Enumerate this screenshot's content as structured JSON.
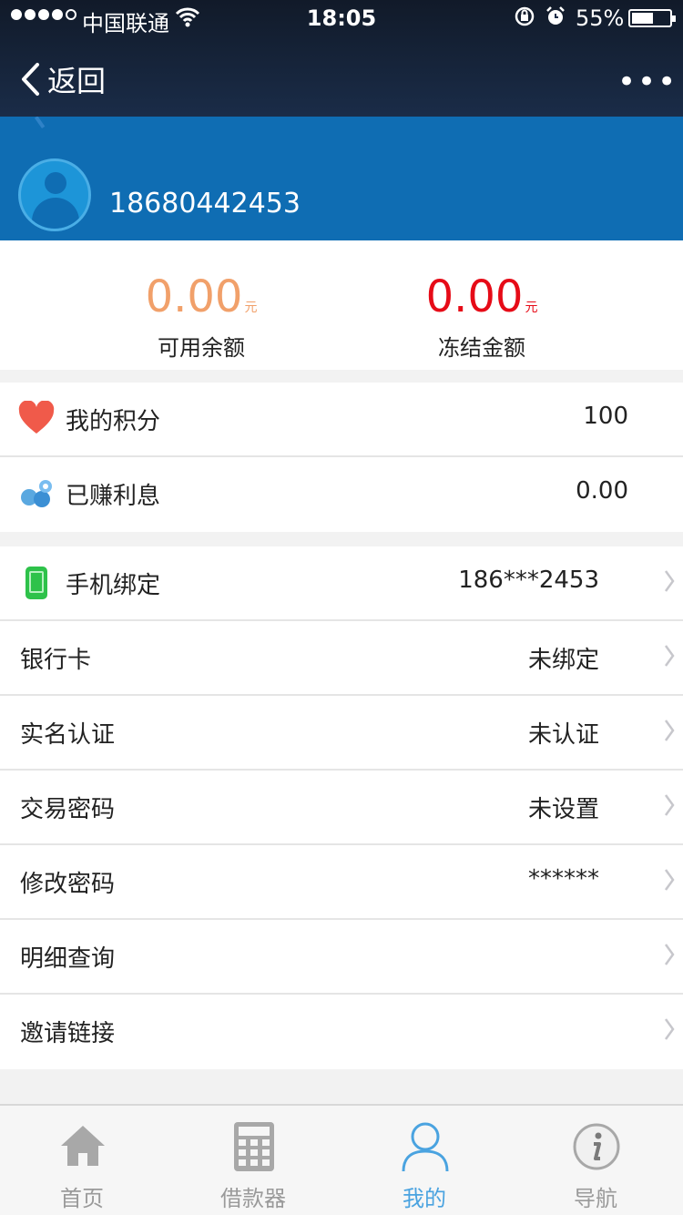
{
  "status_bar": {
    "carrier": "中国联通",
    "time": "18:05",
    "battery_pct": "55%",
    "battery_level": 0.55
  },
  "nav": {
    "back_label": "返回",
    "more_label": "•••"
  },
  "profile": {
    "phone": "18680442453"
  },
  "balances": {
    "available": {
      "amount": "0.00",
      "unit": "元",
      "label": "可用余额",
      "color": "#f1a06a"
    },
    "frozen": {
      "amount": "0.00",
      "unit": "元",
      "label": "冻结金额",
      "color": "#e60b17"
    }
  },
  "stats": [
    {
      "label": "我的积分",
      "value": "100",
      "icon": "heart-icon"
    },
    {
      "label": "已赚利息",
      "value": "0.00",
      "icon": "coins-icon"
    }
  ],
  "account": [
    {
      "label": "手机绑定",
      "value": "186***2453",
      "icon": "mobile-phone-icon"
    },
    {
      "label": "银行卡",
      "value": "未绑定"
    },
    {
      "label": "实名认证",
      "value": "未认证"
    },
    {
      "label": "交易密码",
      "value": "未设置"
    },
    {
      "label": "修改密码",
      "value": "******"
    },
    {
      "label": "明细查询",
      "value": ""
    },
    {
      "label": "邀请链接",
      "value": ""
    }
  ],
  "tabbar": {
    "items": [
      {
        "label": "首页",
        "icon": "home-icon"
      },
      {
        "label": "借款器",
        "icon": "calculator-icon"
      },
      {
        "label": "我的",
        "icon": "user-icon",
        "active": true
      },
      {
        "label": "导航",
        "icon": "info-icon"
      }
    ],
    "active_color": "#4aa3e0"
  },
  "colors": {
    "header_bg": "#0f6db3",
    "topbar_bg": "#1a2c48"
  }
}
